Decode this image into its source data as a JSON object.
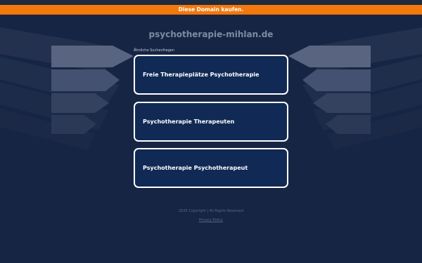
{
  "banner": {
    "label": "Diese Domain kaufen."
  },
  "domain_title": "psychotherapie-mihlan.de",
  "related_searches": {
    "label": "Ähnliche Suchanfragen",
    "items": [
      "Freie Therapieplätze Psychotherapie",
      "Psychotherapie Therapeuten",
      "Psychotherapie Psychotherapeut"
    ]
  },
  "footer": {
    "copyright": "2025 Copyright | All Rights Reserved",
    "privacy_label": "Privacy Policy"
  },
  "colors": {
    "background": "#172544",
    "banner": "#f3780d",
    "card_bg": "#102a55",
    "card_border": "#ffffff"
  }
}
